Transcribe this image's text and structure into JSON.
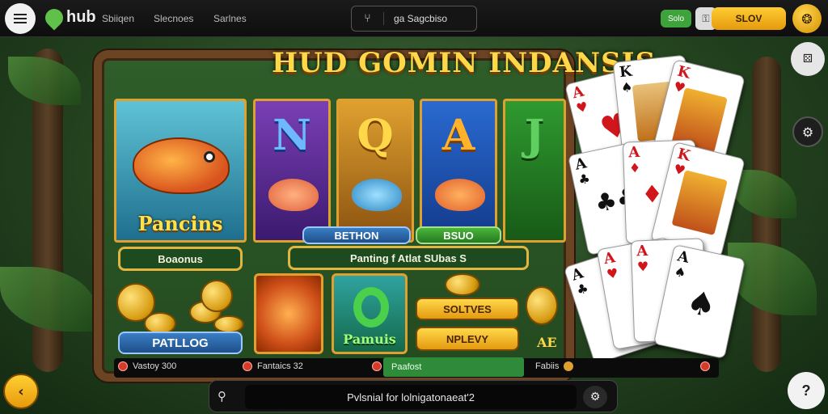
{
  "header": {
    "logo_text": "hub",
    "nav": [
      "Sbiiqen",
      "Slecnoes",
      "Sarlnes"
    ],
    "search_text": "ga Sagcbiso",
    "green_pill": "Solo",
    "lock_icon": "lock-icon",
    "slot_button": "SLOV",
    "profile_icon": "coins-icon"
  },
  "game": {
    "title": "HUD GOMIN INDANSIS",
    "fish_tile_caption": "Pancins",
    "letter_tiles": [
      "N",
      "Q",
      "A",
      "J"
    ],
    "button_bonus": "Boaonus",
    "button_bethon": "BETHON",
    "button_bsuo": "BSUO",
    "banner": "Panting f Atlat SUbas S",
    "button_patllog": "PATLLOG",
    "tile_pamuis": "Pamuis",
    "button_soltves": "SOLTVES",
    "button_nplevy": "NPLEVY",
    "corner_text": "AE"
  },
  "cards": {
    "ranks": [
      "A",
      "K",
      "K",
      "A",
      "A",
      "K",
      "A",
      "A",
      "A",
      "A"
    ]
  },
  "infobar": {
    "item1": "Vastoy 300",
    "item2": "Fantaics 32",
    "item3": "Paafost",
    "item4": "Fabiis"
  },
  "bottom_search": {
    "placeholder": "Pvlsnial for lolnigatonaeat'2",
    "search_icon": "search-icon",
    "action_icon": "share-icon"
  },
  "side": {
    "back_icon": "chevron-left-icon",
    "help_label": "?",
    "btn1_icon": "dice-icon",
    "btn2_icon": "gear-icon"
  }
}
